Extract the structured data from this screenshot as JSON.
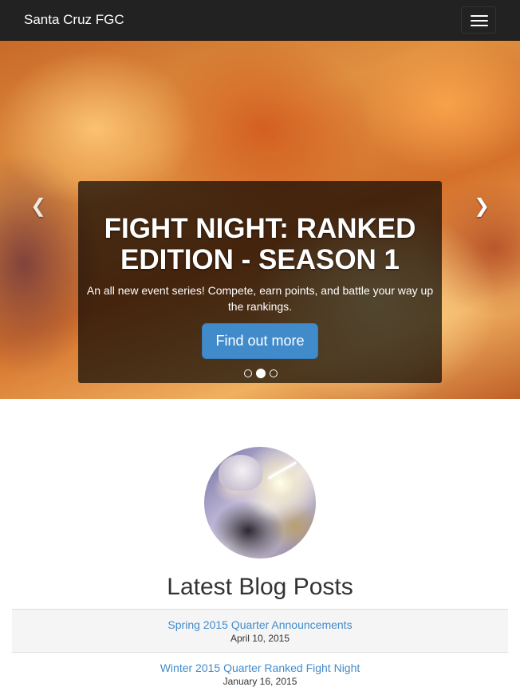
{
  "navbar": {
    "brand": "Santa Cruz FGC",
    "toggle_icon": "hamburger-icon"
  },
  "carousel": {
    "prev_icon": "chevron-left-icon",
    "next_icon": "chevron-right-icon",
    "title": "FIGHT NIGHT: RANKED EDITION - SEASON 1",
    "text": "An all new event series! Compete, earn points, and battle your way up the rankings.",
    "button_label": "Find out more",
    "slide_count": 3,
    "active_slide": 2
  },
  "avatar": {
    "icon": "character-portrait"
  },
  "blog": {
    "heading": "Latest Blog Posts",
    "posts": [
      {
        "title": "Spring 2015 Quarter Announcements",
        "date": "April 10, 2015"
      },
      {
        "title": "Winter 2015 Quarter Ranked Fight Night",
        "date": "January 16, 2015"
      }
    ]
  },
  "colors": {
    "navbar_bg": "#222222",
    "link": "#428bca",
    "button": "#428bca"
  }
}
